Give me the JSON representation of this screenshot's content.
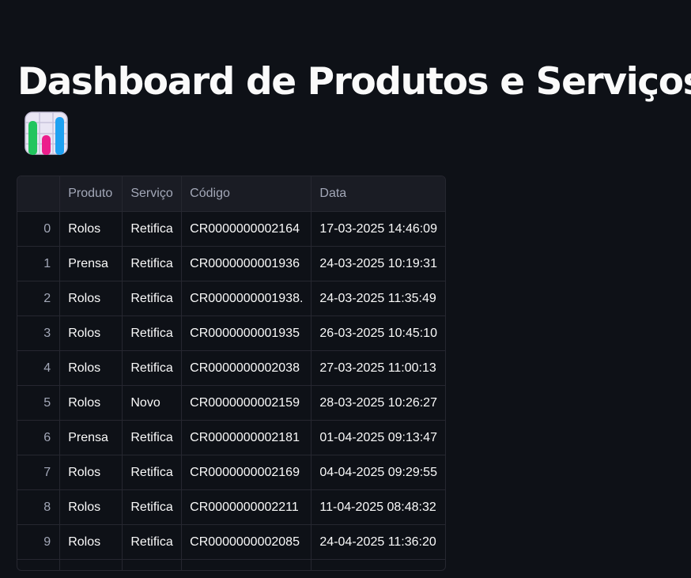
{
  "page": {
    "title": "Dashboard de Produtos e Serviços",
    "title_icon": "bar-chart-emoji-icon"
  },
  "table": {
    "columns": [
      "",
      "Produto",
      "Serviço",
      "Código",
      "Data"
    ],
    "rows": [
      {
        "index": "0",
        "produto": "Rolos",
        "servico": "Retifica",
        "codigo": "CR0000000002164",
        "data": "17-03-2025 14:46:09"
      },
      {
        "index": "1",
        "produto": "Prensa",
        "servico": "Retifica",
        "codigo": "CR0000000001936",
        "data": "24-03-2025 10:19:31"
      },
      {
        "index": "2",
        "produto": "Rolos",
        "servico": "Retifica",
        "codigo": "CR0000000001938.",
        "data": "24-03-2025 11:35:49"
      },
      {
        "index": "3",
        "produto": "Rolos",
        "servico": "Retifica",
        "codigo": "CR0000000001935",
        "data": "26-03-2025 10:45:10"
      },
      {
        "index": "4",
        "produto": "Rolos",
        "servico": "Retifica",
        "codigo": "CR0000000002038",
        "data": "27-03-2025 11:00:13"
      },
      {
        "index": "5",
        "produto": "Rolos",
        "servico": "Novo",
        "codigo": "CR0000000002159",
        "data": "28-03-2025 10:26:27"
      },
      {
        "index": "6",
        "produto": "Prensa",
        "servico": "Retifica",
        "codigo": "CR0000000002181",
        "data": "01-04-2025 09:13:47"
      },
      {
        "index": "7",
        "produto": "Rolos",
        "servico": "Retifica",
        "codigo": "CR0000000002169",
        "data": "04-04-2025 09:29:55"
      },
      {
        "index": "8",
        "produto": "Rolos",
        "servico": "Retifica",
        "codigo": "CR0000000002211",
        "data": "11-04-2025 08:48:32"
      },
      {
        "index": "9",
        "produto": "Rolos",
        "servico": "Retifica",
        "codigo": "CR0000000002085",
        "data": "24-04-2025 11:36:20"
      }
    ]
  },
  "colors": {
    "background": "#0e1117",
    "header_background": "#1a1c24",
    "border": "#262730",
    "text": "#fafafa",
    "muted_text": "#a3a8b8"
  }
}
